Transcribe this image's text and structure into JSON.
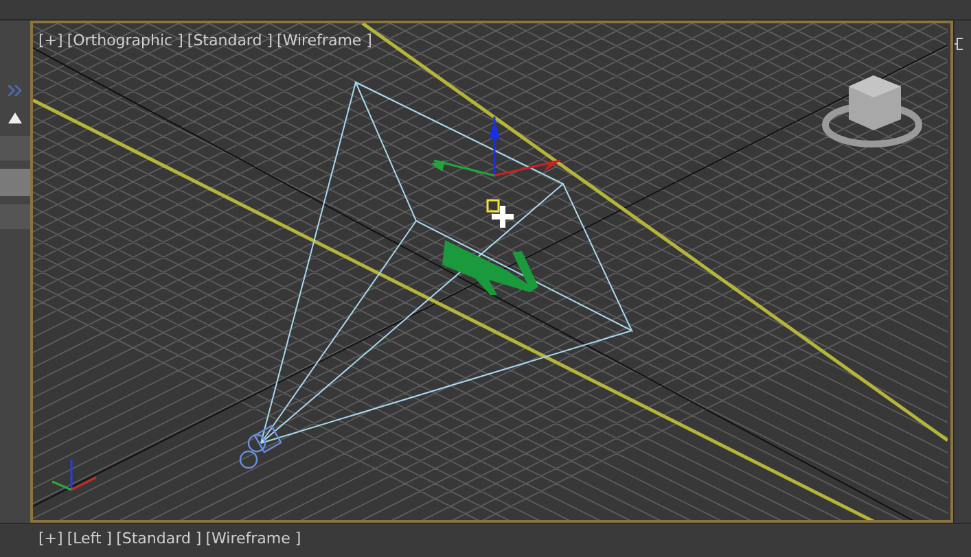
{
  "viewports": [
    {
      "label_parts": [
        "[+]",
        "[Orthographic ]",
        "[Standard ]",
        "[Wireframe ]"
      ],
      "active": true
    },
    {
      "label_parts": [
        "[+]",
        "[Left ]",
        "[Standard ]",
        "[Wireframe ]"
      ],
      "active": false
    }
  ]
}
